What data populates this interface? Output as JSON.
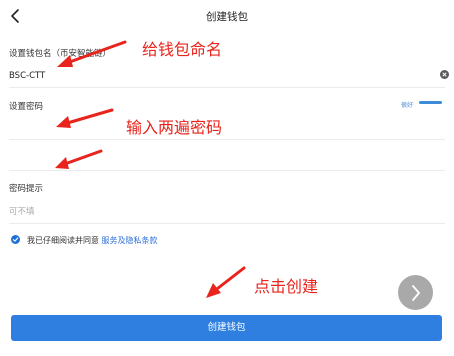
{
  "header": {
    "title": "创建钱包"
  },
  "form": {
    "wallet_name_label": "设置钱包名（币安智能链）",
    "wallet_name_value": "BSC-CTT",
    "password_label": "设置密码",
    "password_strength": "很好",
    "password_hint_label": "密码提示",
    "password_hint_placeholder": "可不填"
  },
  "agreement": {
    "text": "我已仔细阅读并同意",
    "link": "服务及隐私条款",
    "checked": true
  },
  "button": {
    "label": "创建钱包"
  },
  "annotations": {
    "name_wallet": "给钱包命名",
    "enter_password_twice": "输入两遍密码",
    "click_create": "点击创建"
  },
  "colors": {
    "accent": "#2f7fe0",
    "annotation": "#e8241c"
  }
}
